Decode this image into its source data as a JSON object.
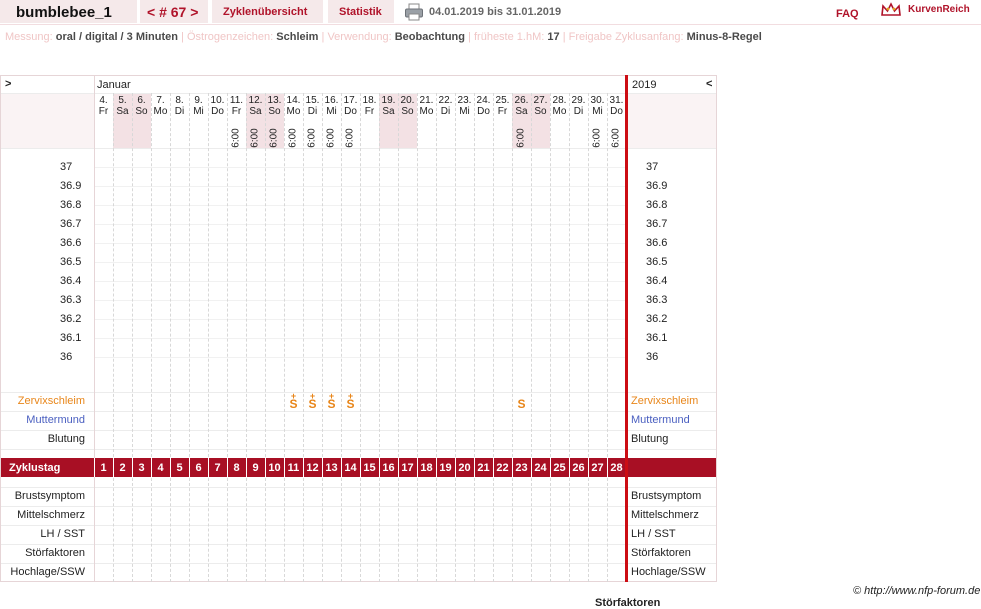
{
  "header": {
    "username": "bumblebee_1",
    "cycle_nav": "< # 67 >",
    "tabs": [
      "Zyklenübersicht",
      "Statistik"
    ],
    "date_range": "04.01.2019 bis 31.01.2019",
    "faq": "FAQ",
    "brand": "KurvenReich"
  },
  "settings": [
    {
      "label": "Messung:",
      "value": "oral / digital / 3 Minuten"
    },
    {
      "label": "Östrogenzeichen:",
      "value": "Schleim"
    },
    {
      "label": "Verwendung:",
      "value": "Beobachtung"
    },
    {
      "label": "früheste 1.hM:",
      "value": "17"
    },
    {
      "label": "Freigabe Zyklusanfang:",
      "value": "Minus-8-Regel"
    }
  ],
  "chart": {
    "left_arrow": ">",
    "right_arrow": "<",
    "month": "Januar",
    "year": "2019",
    "days": [
      {
        "day": "4.",
        "wd": "Fr"
      },
      {
        "day": "5.",
        "wd": "Sa",
        "weekend": true
      },
      {
        "day": "6.",
        "wd": "So",
        "weekend": true
      },
      {
        "day": "7.",
        "wd": "Mo"
      },
      {
        "day": "8.",
        "wd": "Di"
      },
      {
        "day": "9.",
        "wd": "Mi"
      },
      {
        "day": "10.",
        "wd": "Do"
      },
      {
        "day": "11.",
        "wd": "Fr",
        "time": "6:00"
      },
      {
        "day": "12.",
        "wd": "Sa",
        "weekend": true,
        "time": "6:00"
      },
      {
        "day": "13.",
        "wd": "So",
        "weekend": true,
        "time": "6:00"
      },
      {
        "day": "14.",
        "wd": "Mo",
        "time": "6:00"
      },
      {
        "day": "15.",
        "wd": "Di",
        "time": "6:00"
      },
      {
        "day": "16.",
        "wd": "Mi",
        "time": "6:00"
      },
      {
        "day": "17.",
        "wd": "Do",
        "time": "6:00"
      },
      {
        "day": "18.",
        "wd": "Fr"
      },
      {
        "day": "19.",
        "wd": "Sa",
        "weekend": true
      },
      {
        "day": "20.",
        "wd": "So",
        "weekend": true
      },
      {
        "day": "21.",
        "wd": "Mo"
      },
      {
        "day": "22.",
        "wd": "Di"
      },
      {
        "day": "23.",
        "wd": "Mi"
      },
      {
        "day": "24.",
        "wd": "Do"
      },
      {
        "day": "25.",
        "wd": "Fr"
      },
      {
        "day": "26.",
        "wd": "Sa",
        "weekend": true,
        "time": "6:00"
      },
      {
        "day": "27.",
        "wd": "So",
        "weekend": true
      },
      {
        "day": "28.",
        "wd": "Mo"
      },
      {
        "day": "29.",
        "wd": "Di"
      },
      {
        "day": "30.",
        "wd": "Mi",
        "time": "6:00"
      },
      {
        "day": "31.",
        "wd": "Do",
        "time": "6:00"
      }
    ],
    "temp_labels": [
      "37",
      "36.9",
      "36.8",
      "36.7",
      "36.6",
      "36.5",
      "36.4",
      "36.3",
      "36.2",
      "36.1",
      "36"
    ],
    "row_zervix": "Zervixschleim",
    "row_muttermund": "Muttermund",
    "row_blutung": "Blutung",
    "zervix_marks": [
      {
        "day_index": 10,
        "symbol": "S",
        "accent": true
      },
      {
        "day_index": 11,
        "symbol": "S",
        "accent": true
      },
      {
        "day_index": 12,
        "symbol": "S",
        "accent": true
      },
      {
        "day_index": 13,
        "symbol": "S",
        "accent": true
      },
      {
        "day_index": 22,
        "symbol": "S",
        "accent": false
      }
    ],
    "zyklustag_label": "Zyklustag",
    "zyklustag_values": [
      "1",
      "2",
      "3",
      "4",
      "5",
      "6",
      "7",
      "8",
      "9",
      "10",
      "11",
      "12",
      "13",
      "14",
      "15",
      "16",
      "17",
      "18",
      "19",
      "20",
      "21",
      "22",
      "23",
      "24",
      "25",
      "26",
      "27",
      "28"
    ],
    "bottom_rows": [
      "Brustsymptom",
      "Mittelschmerz",
      "LH / SST",
      "Störfaktoren",
      "Hochlage/SSW"
    ],
    "copyright": "© http://www.nfp-forum.de",
    "cut_text": "Störfaktoren"
  },
  "colors": {
    "brand_red": "#b0132a",
    "zervix_orange": "#e8861a",
    "muttermund_blue": "#4a5fc0",
    "weekend_bg": "#f3e1e4"
  }
}
